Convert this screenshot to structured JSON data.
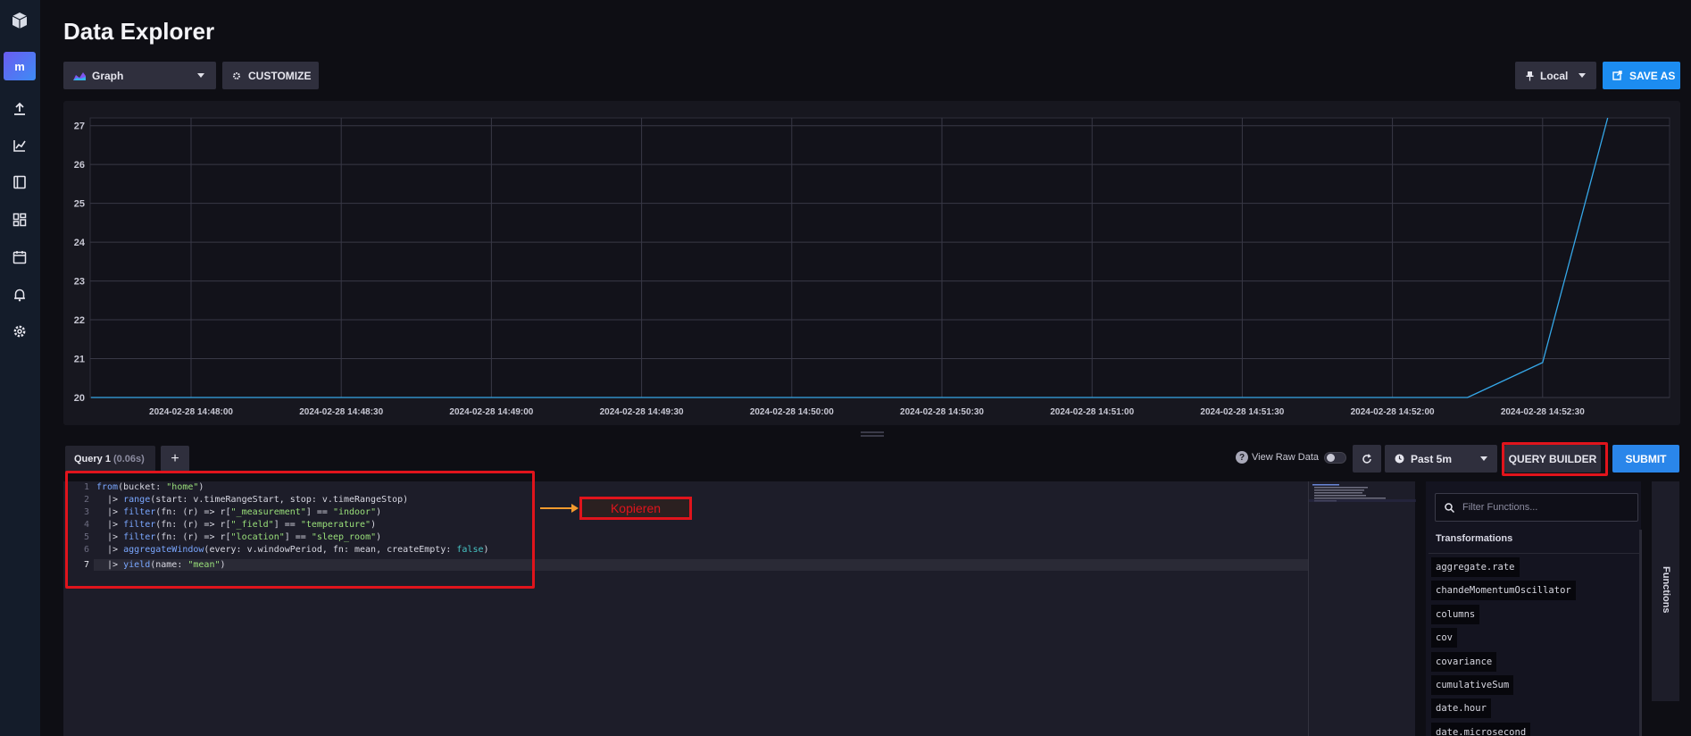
{
  "sidebar": {
    "org_initial": "m",
    "icons": [
      "cube-logo-icon",
      "upload-icon",
      "chart-icon",
      "notebook-icon",
      "dashboard-icon",
      "calendar-icon",
      "bell-icon",
      "gear-icon"
    ]
  },
  "header": {
    "title": "Data Explorer"
  },
  "toolbar": {
    "view_type": "Graph",
    "customize_label": "CUSTOMIZE",
    "timezone": "Local",
    "save_as_label": "SAVE AS"
  },
  "graph": {
    "chart_data": {
      "type": "line",
      "x": [
        "2024-02-28 14:48:00",
        "2024-02-28 14:48:30",
        "2024-02-28 14:49:00",
        "2024-02-28 14:49:30",
        "2024-02-28 14:50:00",
        "2024-02-28 14:50:30",
        "2024-02-28 14:51:00",
        "2024-02-28 14:51:30",
        "2024-02-28 14:52:00",
        "2024-02-28 14:52:30"
      ],
      "xlabel": "",
      "ylabel": "",
      "ylim": [
        20,
        27.2
      ],
      "yticks": [
        27,
        26,
        25,
        24,
        23,
        22,
        21,
        20
      ],
      "grid": true,
      "series_color": "#35a7e8",
      "series": [
        {
          "points": [
            {
              "x": "2024-02-28 14:47:40",
              "y": 20.0
            },
            {
              "x": "2024-02-28 14:52:15",
              "y": 20.0
            },
            {
              "x": "2024-02-28 14:52:30",
              "y": 20.9
            },
            {
              "x": "2024-02-28 14:52:43",
              "y": 27.2
            }
          ]
        }
      ]
    }
  },
  "query": {
    "tab_label": "Query 1",
    "tab_time": "(0.06s)",
    "add_label": "+",
    "raw_data_icon": "?",
    "raw_data_label": "View Raw Data",
    "time_range": "Past 5m",
    "query_builder_label": "QUERY BUILDER",
    "submit_label": "SUBMIT"
  },
  "editor": {
    "lines": [
      {
        "n": "1",
        "text": "from(bucket: \"home\")"
      },
      {
        "n": "2",
        "text": "  |> range(start: v.timeRangeStart, stop: v.timeRangeStop)"
      },
      {
        "n": "3",
        "text": "  |> filter(fn: (r) => r[\"_measurement\"] == \"indoor\")"
      },
      {
        "n": "4",
        "text": "  |> filter(fn: (r) => r[\"_field\"] == \"temperature\")"
      },
      {
        "n": "5",
        "text": "  |> filter(fn: (r) => r[\"location\"] == \"sleep_room\")"
      },
      {
        "n": "6",
        "text": "  |> aggregateWindow(every: v.windowPeriod, fn: mean, createEmpty: false)"
      },
      {
        "n": "7",
        "text": "  |> yield(name: \"mean\")"
      }
    ]
  },
  "annotation": {
    "label": "Kopieren"
  },
  "functions": {
    "search_placeholder": "Filter Functions...",
    "heading": "Transformations",
    "side_label": "Functions",
    "items": [
      "aggregate.rate",
      "chandeMomentumOscillator",
      "columns",
      "cov",
      "covariance",
      "cumulativeSum",
      "date.hour",
      "date.microsecond"
    ]
  }
}
